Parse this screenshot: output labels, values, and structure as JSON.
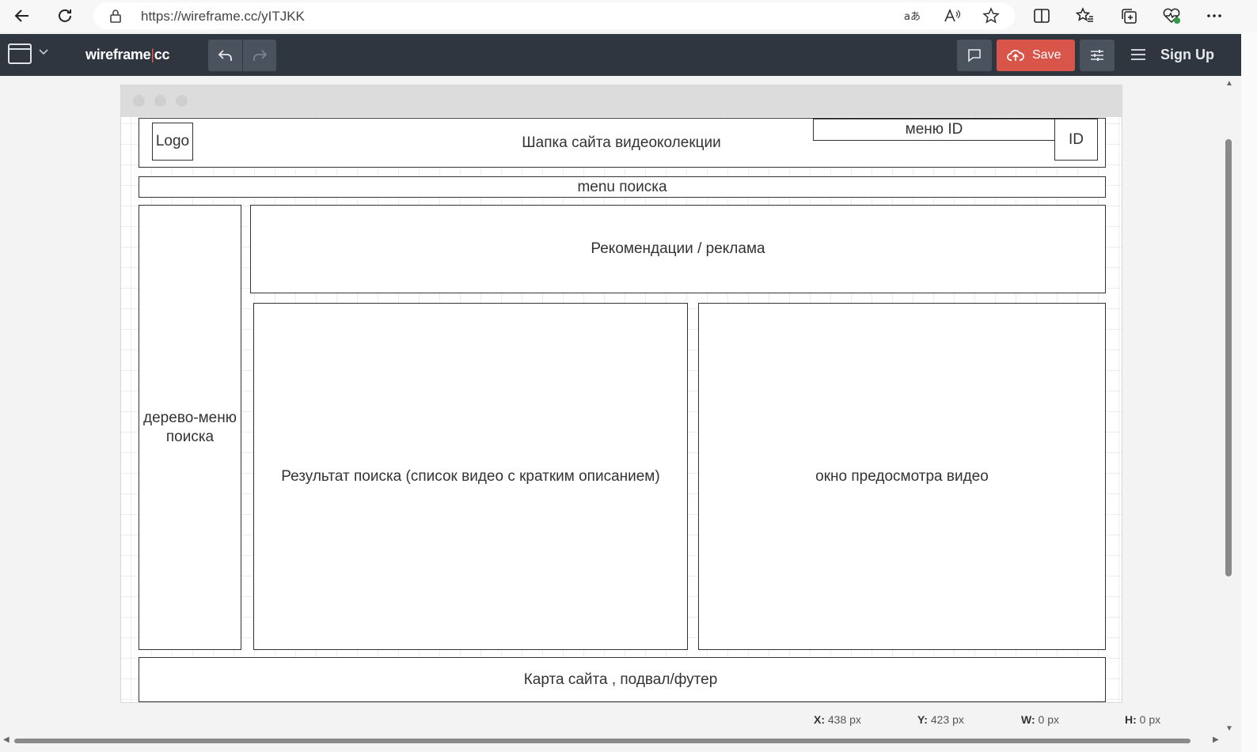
{
  "browser": {
    "url": "https://wireframe.cc/yITJKK"
  },
  "app": {
    "brand_left": "wireframe",
    "brand_sep": "|",
    "brand_right": "cc",
    "save_label": "Save",
    "signup_label": "Sign Up"
  },
  "wireframe": {
    "header": "Шапка сайта видеоколекции",
    "logo": "Logo",
    "menu_id": "меню ID",
    "id": "ID",
    "search_menu": "menu поиска",
    "tree_menu": "дерево-меню поиска",
    "recommendations": "Рекомендации / реклама",
    "results": "Результат поиска (список видео с кратким описанием)",
    "preview": "окно предосмотра видео",
    "footer": "Карта сайта , подвал/футер"
  },
  "status": {
    "x_label": "X:",
    "x_value": "438 px",
    "y_label": "Y:",
    "y_value": "423 px",
    "w_label": "W:",
    "w_value": "0 px",
    "h_label": "H:",
    "h_value": "0 px"
  },
  "colors": {
    "toolbar": "#2f3640",
    "save": "#d9554a",
    "brand_separator": "#e65b4c"
  }
}
